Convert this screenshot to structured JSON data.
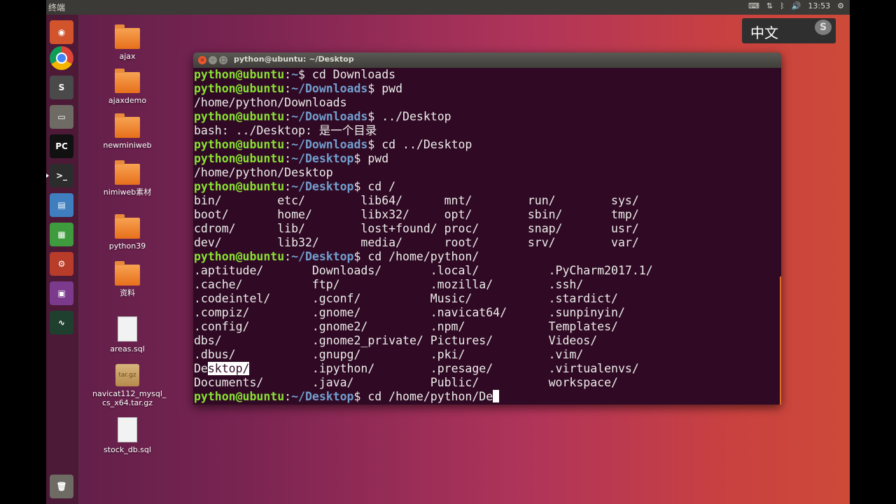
{
  "topbar": {
    "app_title": "终端",
    "clock": "13:53"
  },
  "ime": {
    "label": "中文",
    "logo": "S"
  },
  "launcher": [
    {
      "name": "ubuntu-dash",
      "color": "#d2542c",
      "glyph": "◉"
    },
    {
      "name": "chrome",
      "color": "#ffffff",
      "glyph": ""
    },
    {
      "name": "sublime-text",
      "color": "#4a4a4a",
      "glyph": "S"
    },
    {
      "name": "files",
      "color": "#6d6b63",
      "glyph": "▭"
    },
    {
      "name": "pycharm",
      "color": "#111111",
      "glyph": "PC"
    },
    {
      "name": "terminal",
      "color": "#2c2c2c",
      "glyph": ">_"
    },
    {
      "name": "libreoffice-writer",
      "color": "#3f7fbf",
      "glyph": "▤"
    },
    {
      "name": "libreoffice-calc",
      "color": "#3e9b3e",
      "glyph": "▦"
    },
    {
      "name": "system-settings",
      "color": "#b83c2a",
      "glyph": "⚙"
    },
    {
      "name": "workspace-switcher",
      "color": "#7b3a8c",
      "glyph": "▣"
    },
    {
      "name": "system-monitor",
      "color": "#1f3f2f",
      "glyph": "∿"
    },
    {
      "name": "trash",
      "color": "#6d6b63",
      "glyph": "🗑"
    }
  ],
  "desktop_icons": [
    {
      "label": "ajax",
      "kind": "folder"
    },
    {
      "label": "ajaxdemo",
      "kind": "folder"
    },
    {
      "label": "newminiweb",
      "kind": "folder"
    },
    {
      "label": "nimiweb素材",
      "kind": "folder"
    },
    {
      "label": "python39",
      "kind": "folder"
    },
    {
      "label": "资料",
      "kind": "folder"
    },
    {
      "label": "areas.sql",
      "kind": "file"
    },
    {
      "label": "navicat112_mysql_\ncs_x64.tar.gz",
      "kind": "archive",
      "badge": "tar.gz"
    },
    {
      "label": "stock_db.sql",
      "kind": "file"
    }
  ],
  "terminal": {
    "title": "python@ubuntu: ~/Desktop",
    "lines": [
      [
        {
          "t": "python@ubuntu",
          "c": "user"
        },
        {
          "t": ":"
        },
        {
          "t": "~",
          "c": "path"
        },
        {
          "t": "$ cd Downloads"
        }
      ],
      [
        {
          "t": "python@ubuntu",
          "c": "user"
        },
        {
          "t": ":"
        },
        {
          "t": "~/Downloads",
          "c": "path"
        },
        {
          "t": "$ pwd"
        }
      ],
      [
        {
          "t": "/home/python/Downloads"
        }
      ],
      [
        {
          "t": "python@ubuntu",
          "c": "user"
        },
        {
          "t": ":"
        },
        {
          "t": "~/Downloads",
          "c": "path"
        },
        {
          "t": "$ ../Desktop"
        }
      ],
      [
        {
          "t": "bash: ../Desktop: 是一个目录"
        }
      ],
      [
        {
          "t": "python@ubuntu",
          "c": "user"
        },
        {
          "t": ":"
        },
        {
          "t": "~/Downloads",
          "c": "path"
        },
        {
          "t": "$ cd ../Desktop"
        }
      ],
      [
        {
          "t": "python@ubuntu",
          "c": "user"
        },
        {
          "t": ":"
        },
        {
          "t": "~/Desktop",
          "c": "path"
        },
        {
          "t": "$ pwd"
        }
      ],
      [
        {
          "t": "/home/python/Desktop"
        }
      ],
      [
        {
          "t": "python@ubuntu",
          "c": "user"
        },
        {
          "t": ":"
        },
        {
          "t": "~/Desktop",
          "c": "path"
        },
        {
          "t": "$ cd /"
        }
      ],
      [
        {
          "t": "bin/        etc/        lib64/      mnt/        run/        sys/"
        }
      ],
      [
        {
          "t": "boot/       home/       libx32/     opt/        sbin/       tmp/"
        }
      ],
      [
        {
          "t": "cdrom/      lib/        lost+found/ proc/       snap/       usr/"
        }
      ],
      [
        {
          "t": "dev/        lib32/      media/      root/       srv/        var/"
        }
      ],
      [
        {
          "t": "python@ubuntu",
          "c": "user"
        },
        {
          "t": ":"
        },
        {
          "t": "~/Desktop",
          "c": "path"
        },
        {
          "t": "$ cd /home/python/"
        }
      ],
      [
        {
          "t": ".aptitude/       Downloads/       .local/          .PyCharm2017.1/"
        }
      ],
      [
        {
          "t": ".cache/          ftp/             .mozilla/        .ssh/"
        }
      ],
      [
        {
          "t": ".codeintel/      .gconf/          Music/           .stardict/"
        }
      ],
      [
        {
          "t": ".compiz/         .gnome/          .navicat64/      .sunpinyin/"
        }
      ],
      [
        {
          "t": ".config/         .gnome2/         .npm/            Templates/"
        }
      ],
      [
        {
          "t": "dbs/             .gnome2_private/ Pictures/        Videos/"
        }
      ],
      [
        {
          "t": ".dbus/           .gnupg/          .pki/            .vim/"
        }
      ],
      [
        {
          "t": "De"
        },
        {
          "t": "sktop/",
          "c": "sel"
        },
        {
          "t": "         .ipython/        .presage/        .virtualenvs/"
        }
      ],
      [
        {
          "t": "Documents/       .java/           Public/          workspace/"
        }
      ],
      [
        {
          "t": "python@ubuntu",
          "c": "user"
        },
        {
          "t": ":"
        },
        {
          "t": "~/Desktop",
          "c": "path"
        },
        {
          "t": "$ cd /home/python/De"
        },
        {
          "t": "",
          "c": "cursor"
        }
      ]
    ]
  }
}
